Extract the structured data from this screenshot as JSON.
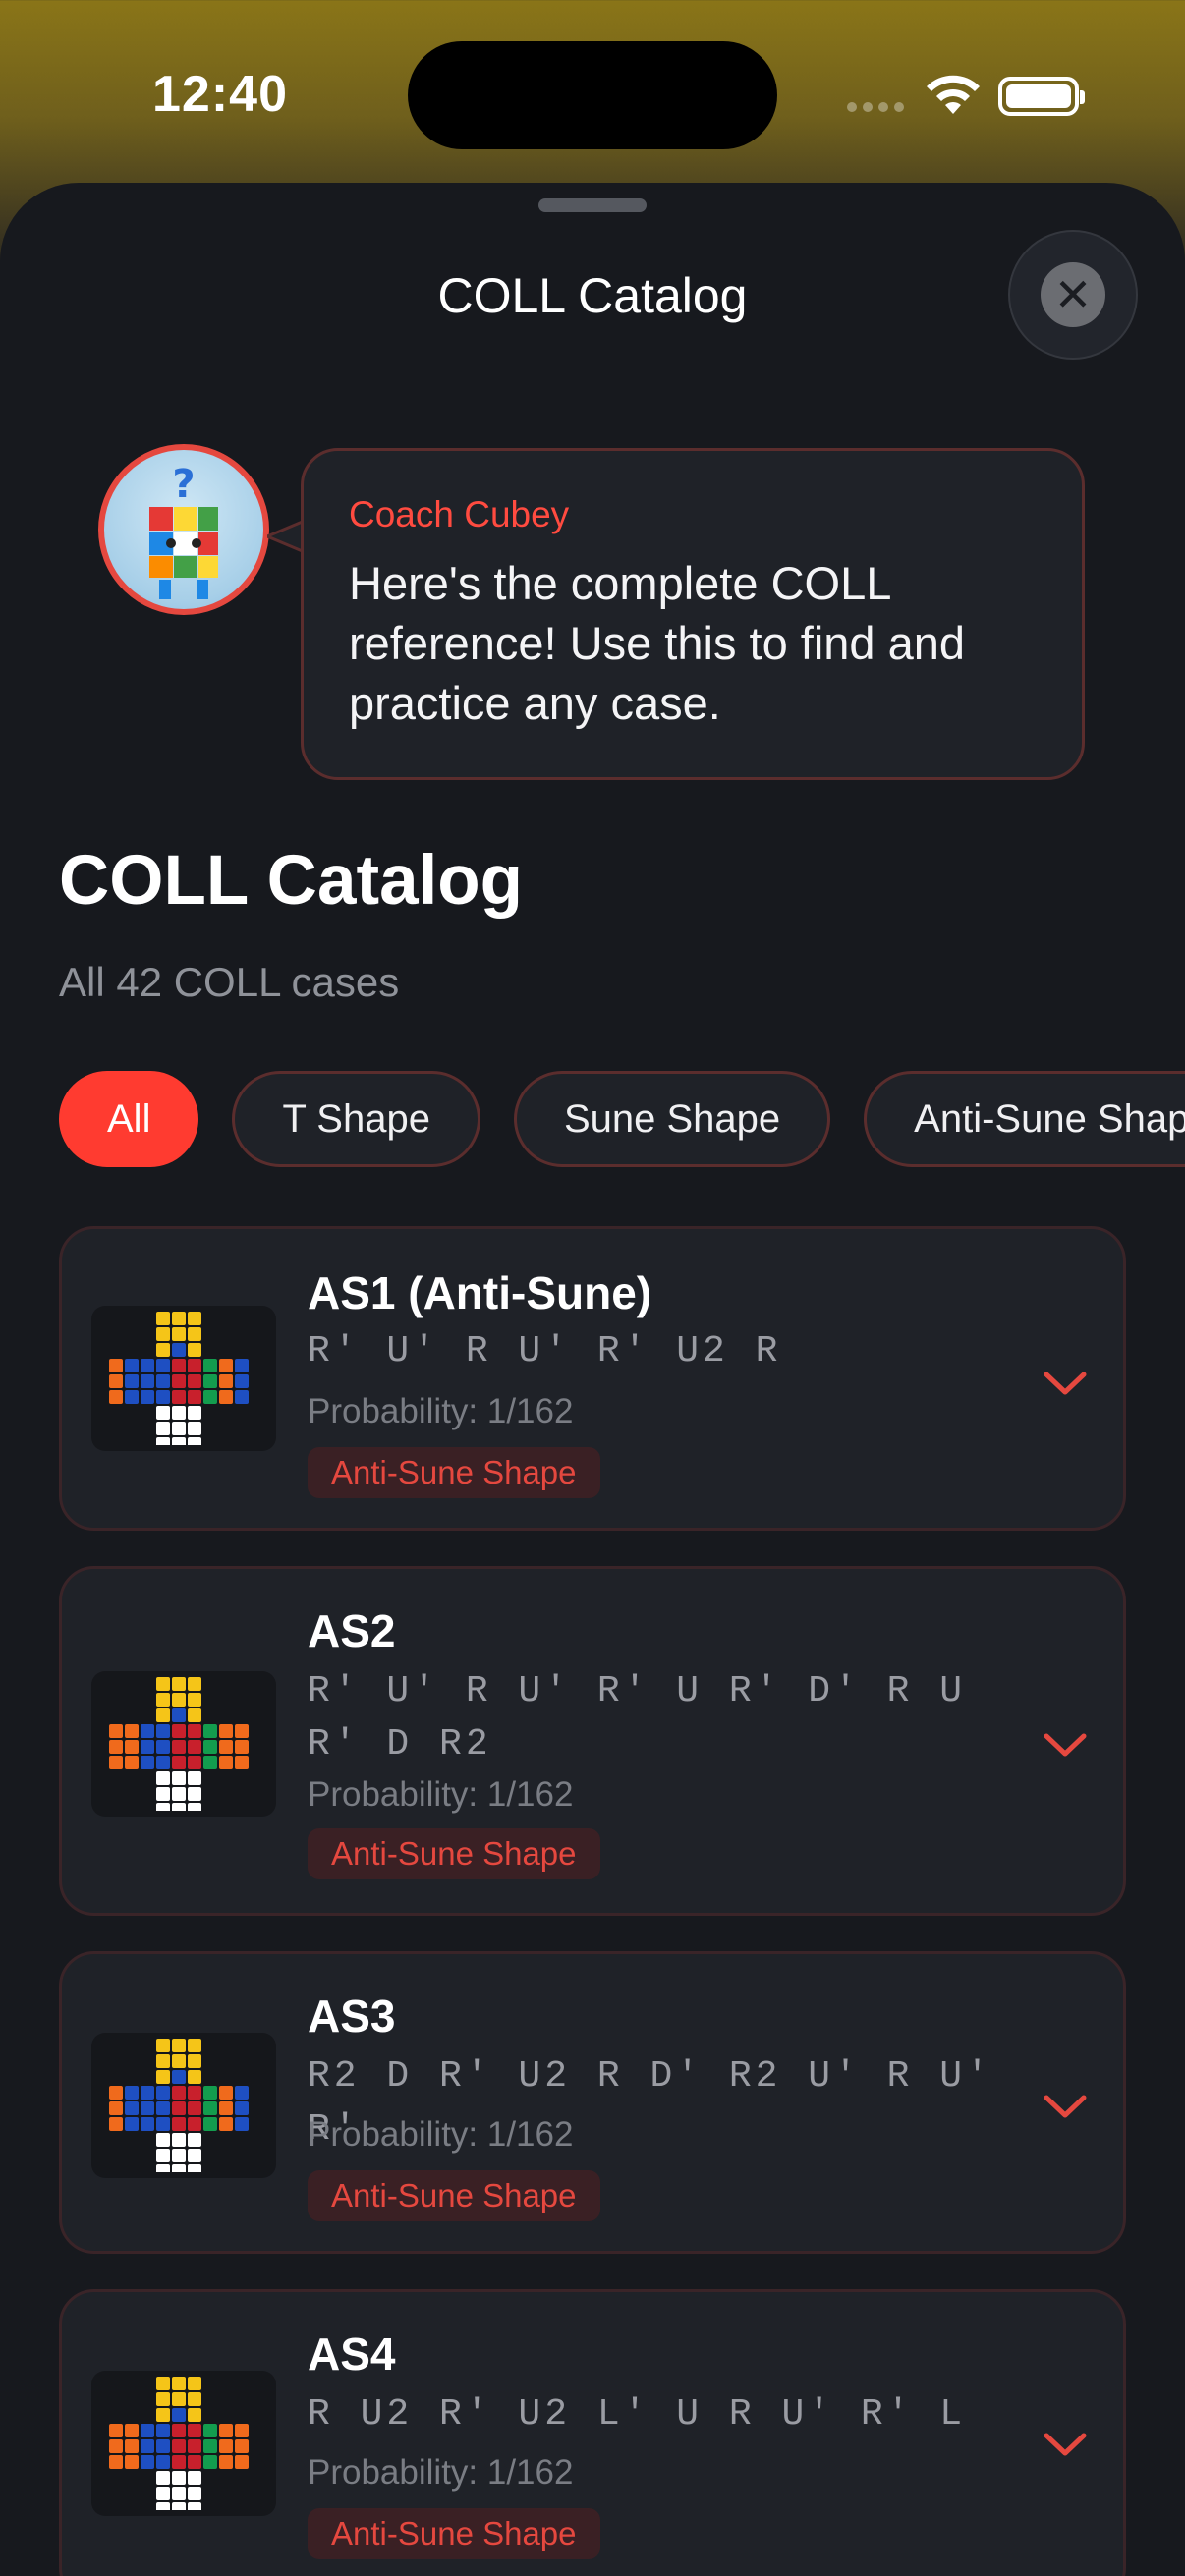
{
  "status_bar": {
    "time": "12:40"
  },
  "sheet": {
    "title": "COLL Catalog",
    "close_icon": "close-icon"
  },
  "coach": {
    "name": "Coach Cubey",
    "message": "Here's the complete COLL reference! Use this to find and practice any case."
  },
  "catalog": {
    "title": "COLL Catalog",
    "subtitle": "All 42 COLL cases"
  },
  "filters": [
    {
      "label": "All",
      "active": true
    },
    {
      "label": "T Shape",
      "active": false
    },
    {
      "label": "Sune Shape",
      "active": false
    },
    {
      "label": "Anti-Sune Shape",
      "active": false
    }
  ],
  "cases": [
    {
      "name": "AS1 (Anti-Sune)",
      "alg": "R' U' R U' R' U2 R",
      "probability": "Probability: 1/162",
      "tag": "Anti-Sune Shape"
    },
    {
      "name": "AS2",
      "alg": "R' U' R U' R' U R' D' R U R' D R2",
      "probability": "Probability: 1/162",
      "tag": "Anti-Sune Shape"
    },
    {
      "name": "AS3",
      "alg": "R2 D R' U2 R D' R2 U' R U' R'",
      "probability": "Probability: 1/162",
      "tag": "Anti-Sune Shape"
    },
    {
      "name": "AS4",
      "alg": "R U2 R' U2 L' U R U' R' L",
      "probability": "Probability: 1/162",
      "tag": "Anti-Sune Shape"
    }
  ],
  "colors": {
    "accent": "#ff3b30",
    "background": "#17191e",
    "card": "#1f2228"
  }
}
